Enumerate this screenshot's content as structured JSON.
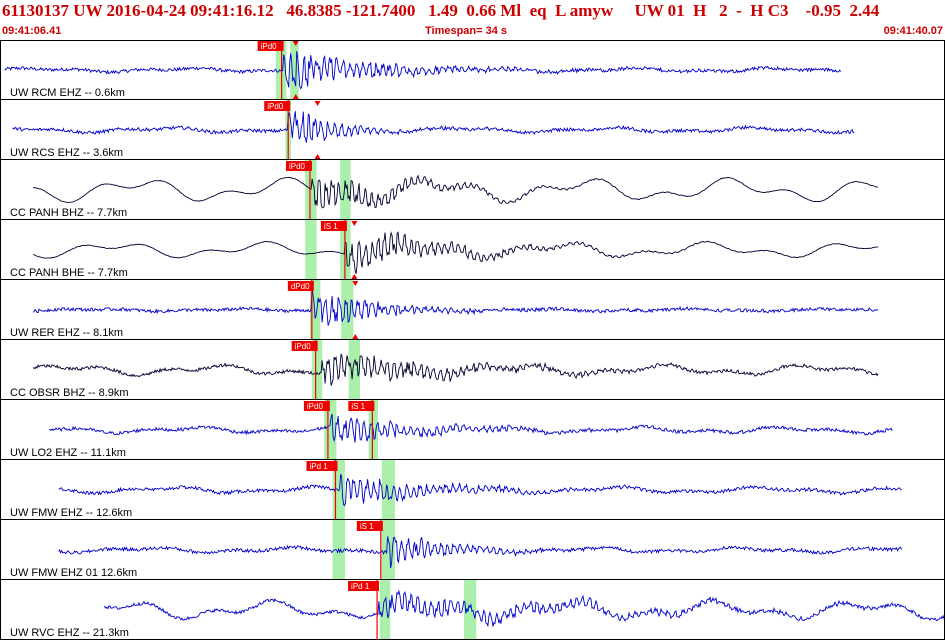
{
  "header": {
    "event_line": "61130137 UW 2016-04-24 09:41:16.12   46.8385 -121.7400   1.49  0.66 Ml  eq  L amyw     UW 01  H   2  -  H C3    -0.95  2.44",
    "start_time": "09:41:06.41",
    "timespan_label": "Timespan=  34 s",
    "end_time": "09:41:40.07"
  },
  "colors": {
    "header_text": "#cc0000",
    "trace_blue": "#0000cc",
    "trace_dark": "#000033",
    "pick_red": "#ee0000",
    "window_green": "#aaf0aa",
    "grid": "#000000"
  },
  "channels": [
    {
      "label": "UW RCM EHZ -- 0.6km",
      "color": "blue",
      "amp": 0.08,
      "start": 0.005,
      "end": 0.89,
      "ev": 0.3,
      "ev_amp": 0.85,
      "decay": 0.09,
      "noise": "high",
      "picks": [
        {
          "text": "iPd0",
          "t": 0.298
        }
      ],
      "windows": [
        [
          0.292,
          0.303
        ],
        [
          0.307,
          0.316
        ]
      ],
      "arrow_t": 0.313
    },
    {
      "label": "UW RCS EHZ -- 3.6km",
      "color": "blue",
      "amp": 0.1,
      "start": 0.013,
      "end": 0.905,
      "ev": 0.305,
      "ev_amp": 0.8,
      "decay": 0.05,
      "noise": "high",
      "picks": [
        {
          "text": "iPd0",
          "t": 0.305
        }
      ],
      "windows": [
        [
          0.302,
          0.308
        ]
      ],
      "arrow_t": 0.336
    },
    {
      "label": "CC PANH BHZ -- 7.7km",
      "color": "dark",
      "amp": 0.45,
      "start": 0.035,
      "end": 0.93,
      "ev": 0.33,
      "ev_amp": 0.7,
      "decay": 0.09,
      "noise": "low",
      "picks": [
        {
          "text": "iPd0",
          "t": 0.328
        }
      ],
      "windows": [
        [
          0.323,
          0.335
        ],
        [
          0.36,
          0.371
        ]
      ]
    },
    {
      "label": "CC PANH BHE -- 7.7km",
      "color": "dark",
      "amp": 0.3,
      "start": 0.035,
      "end": 0.93,
      "ev": 0.365,
      "ev_amp": 0.75,
      "decay": 0.1,
      "noise": "low",
      "picks": [
        {
          "text": "iS 1",
          "t": 0.365
        }
      ],
      "windows": [
        [
          0.323,
          0.335
        ],
        [
          0.36,
          0.371
        ]
      ],
      "arrow_t": 0.375
    },
    {
      "label": "UW RER EHZ -- 8.1km",
      "color": "blue",
      "amp": 0.05,
      "start": 0.035,
      "end": 0.93,
      "ev": 0.33,
      "ev_amp": 0.85,
      "decay": 0.06,
      "noise": "high",
      "picks": [
        {
          "text": "dPd0",
          "t": 0.33
        }
      ],
      "windows": [
        [
          0.328,
          0.339
        ],
        [
          0.361,
          0.374
        ]
      ],
      "arrow_t": 0.376
    },
    {
      "label": "CC OBSR BHZ -- 8.9km",
      "color": "dark",
      "amp": 0.2,
      "start": 0.035,
      "end": 0.93,
      "ev": 0.34,
      "ev_amp": 0.65,
      "decay": 0.12,
      "noise": "mixed",
      "picks": [
        {
          "text": "iPd0",
          "t": 0.334
        }
      ],
      "windows": [
        [
          0.33,
          0.341
        ],
        [
          0.369,
          0.381
        ]
      ]
    },
    {
      "label": "UW LO2 EHZ -- 11.1km",
      "color": "blue",
      "amp": 0.12,
      "start": 0.052,
      "end": 0.945,
      "ev": 0.35,
      "ev_amp": 0.6,
      "decay": 0.09,
      "noise": "high",
      "picks": [
        {
          "text": "iPd0",
          "t": 0.347
        },
        {
          "text": "iS 1",
          "t": 0.394
        }
      ],
      "windows": [
        [
          0.343,
          0.356
        ],
        [
          0.39,
          0.4
        ]
      ]
    },
    {
      "label": "UW FMW EHZ -- 12.6km",
      "color": "blue",
      "amp": 0.12,
      "start": 0.062,
      "end": 0.955,
      "ev": 0.36,
      "ev_amp": 0.65,
      "decay": 0.09,
      "noise": "high",
      "picks": [
        {
          "text": "iPd 1",
          "t": 0.355
        }
      ],
      "windows": [
        [
          0.352,
          0.365
        ],
        [
          0.404,
          0.418
        ]
      ]
    },
    {
      "label": "UW FMW EHZ 01 12.6km",
      "color": "blue",
      "amp": 0.1,
      "start": 0.062,
      "end": 0.955,
      "ev": 0.41,
      "ev_amp": 0.65,
      "decay": 0.06,
      "noise": "high",
      "picks": [
        {
          "text": "iS 1",
          "t": 0.403
        }
      ],
      "windows": [
        [
          0.352,
          0.365
        ],
        [
          0.404,
          0.418
        ]
      ]
    },
    {
      "label": "UW RVC EHZ -- 21.3km",
      "color": "blue",
      "amp": 0.35,
      "start": 0.11,
      "end": 1.0,
      "ev": 0.4,
      "ev_amp": 0.45,
      "decay": 0.2,
      "noise": "high",
      "picks": [
        {
          "text": "iPd 1",
          "t": 0.399
        }
      ],
      "windows": [
        [
          0.402,
          0.413
        ],
        [
          0.491,
          0.504
        ]
      ]
    }
  ]
}
